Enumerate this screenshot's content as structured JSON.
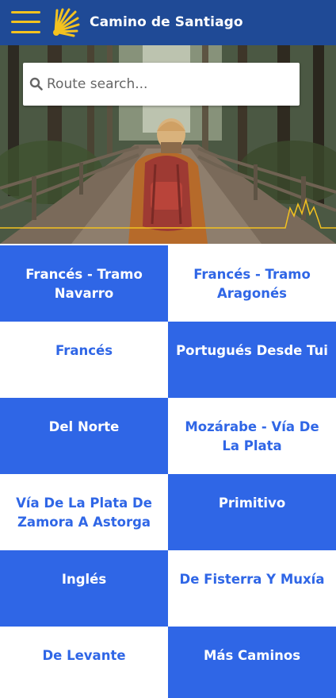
{
  "app_title": "Camino de Santiago",
  "search": {
    "placeholder": "Route search..."
  },
  "colors": {
    "appbar": "#1f4a96",
    "accent_yellow": "#f4c21f",
    "tile_blue": "#2f66e6",
    "tile_white": "#ffffff"
  },
  "routes": [
    {
      "label": "Francés - Tramo Navarro",
      "style": "blue"
    },
    {
      "label": "Francés - Tramo Aragonés",
      "style": "white"
    },
    {
      "label": "Francés",
      "style": "white"
    },
    {
      "label": "Portugués Desde Tui",
      "style": "blue"
    },
    {
      "label": "Del Norte",
      "style": "blue"
    },
    {
      "label": "Mozárabe - Vía De La Plata",
      "style": "white"
    },
    {
      "label": "Vía De La Plata De Zamora A Astorga",
      "style": "white"
    },
    {
      "label": "Primitivo",
      "style": "blue"
    },
    {
      "label": "Inglés",
      "style": "blue"
    },
    {
      "label": "De Fisterra Y Muxía",
      "style": "white"
    },
    {
      "label": "De Levante",
      "style": "white"
    },
    {
      "label": "Más Caminos",
      "style": "blue"
    }
  ]
}
